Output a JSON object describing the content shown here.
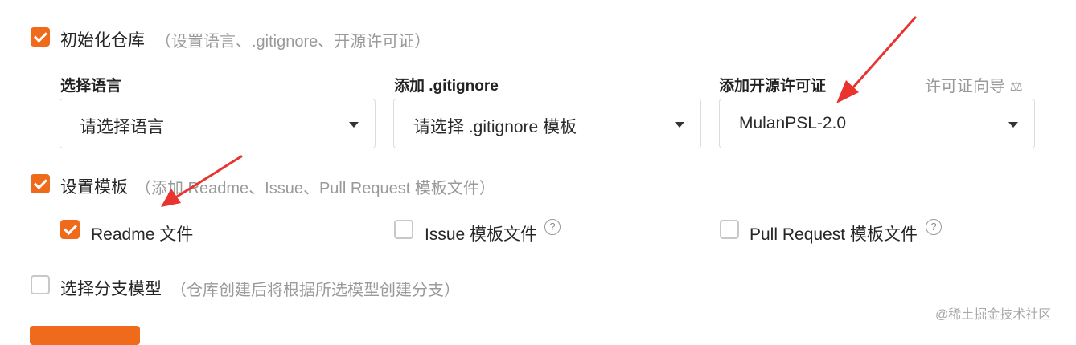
{
  "init_repo": {
    "label": "初始化仓库",
    "hint": "（设置语言、.gitignore、开源许可证）",
    "checked": true
  },
  "columns": {
    "language": {
      "title": "选择语言",
      "select_value": "请选择语言"
    },
    "gitignore": {
      "title": "添加 .gitignore",
      "select_value": "请选择 .gitignore 模板"
    },
    "license": {
      "title": "添加开源许可证",
      "select_value": "MulanPSL-2.0",
      "guide_link": "许可证向导",
      "guide_icon": "⚖"
    }
  },
  "templates": {
    "label": "设置模板",
    "hint": "（添加 Readme、Issue、Pull Request 模板文件）",
    "checked": true,
    "options": [
      {
        "label": "Readme 文件",
        "checked": true
      },
      {
        "label": "Issue 模板文件",
        "checked": false,
        "help": "?"
      },
      {
        "label": "Pull Request 模板文件",
        "checked": false,
        "help": "?"
      }
    ]
  },
  "branch_model": {
    "label": "选择分支模型",
    "hint": "（仓库创建后将根据所选模型创建分支）",
    "checked": false
  },
  "watermark": "@稀土掘金技术社区",
  "colors": {
    "accent": "#f06a1b",
    "arrow": "#e8332f"
  }
}
